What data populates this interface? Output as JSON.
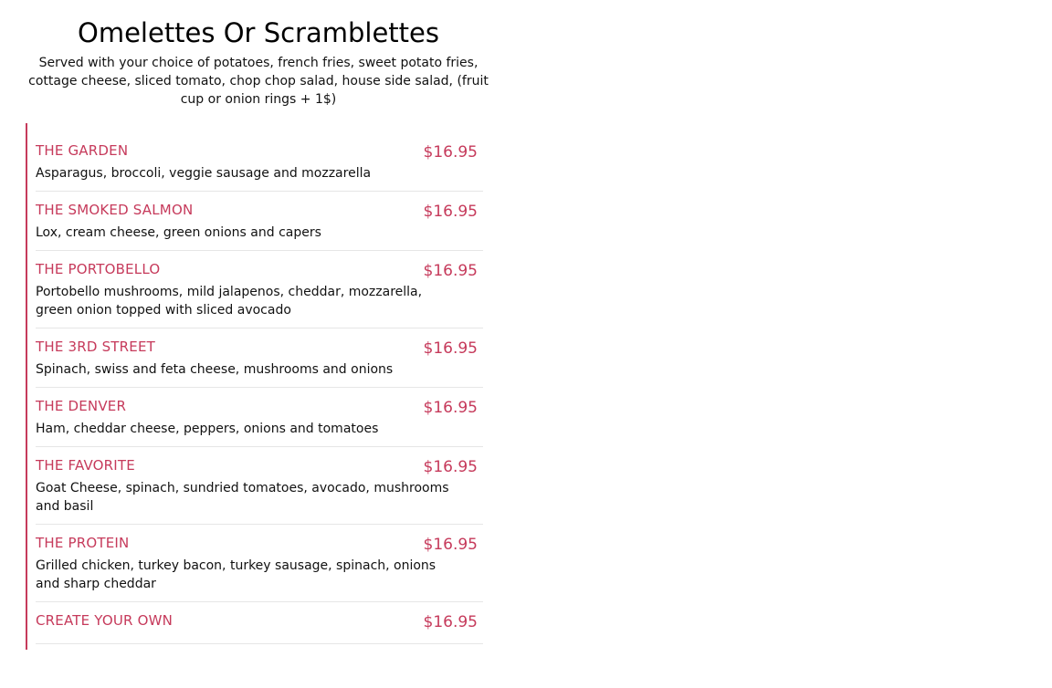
{
  "section": {
    "title": "Omelettes Or Scramblettes",
    "subtitle": "Served with your choice of potatoes, french fries, sweet potato fries, cottage cheese, sliced tomato, chop chop salad, house side salad, (fruit cup or onion rings + 1$)"
  },
  "items": [
    {
      "name": "THE GARDEN",
      "price": "$16.95",
      "description": "Asparagus, broccoli, veggie sausage and mozzarella"
    },
    {
      "name": "THE SMOKED SALMON",
      "price": "$16.95",
      "description": "Lox, cream cheese, green onions and capers"
    },
    {
      "name": "THE PORTOBELLO",
      "price": "$16.95",
      "description": "Portobello mushrooms, mild jalapenos, cheddar, mozzarella, green onion topped with sliced avocado"
    },
    {
      "name": "THE 3RD STREET",
      "price": "$16.95",
      "description": "Spinach, swiss and feta cheese, mushrooms and onions"
    },
    {
      "name": "THE DENVER",
      "price": "$16.95",
      "description": "Ham, cheddar cheese, peppers, onions and tomatoes"
    },
    {
      "name": "THE FAVORITE",
      "price": "$16.95",
      "description": "Goat Cheese, spinach, sundried tomatoes, avocado, mushrooms and basil"
    },
    {
      "name": "THE PROTEIN",
      "price": "$16.95",
      "description": "Grilled chicken, turkey bacon, turkey sausage, spinach, onions and sharp cheddar"
    },
    {
      "name": "CREATE YOUR OWN",
      "price": "$16.95",
      "description": ""
    }
  ],
  "colors": {
    "accent": "#c63a5b",
    "text": "#111111",
    "divider": "#e6e6e6"
  }
}
